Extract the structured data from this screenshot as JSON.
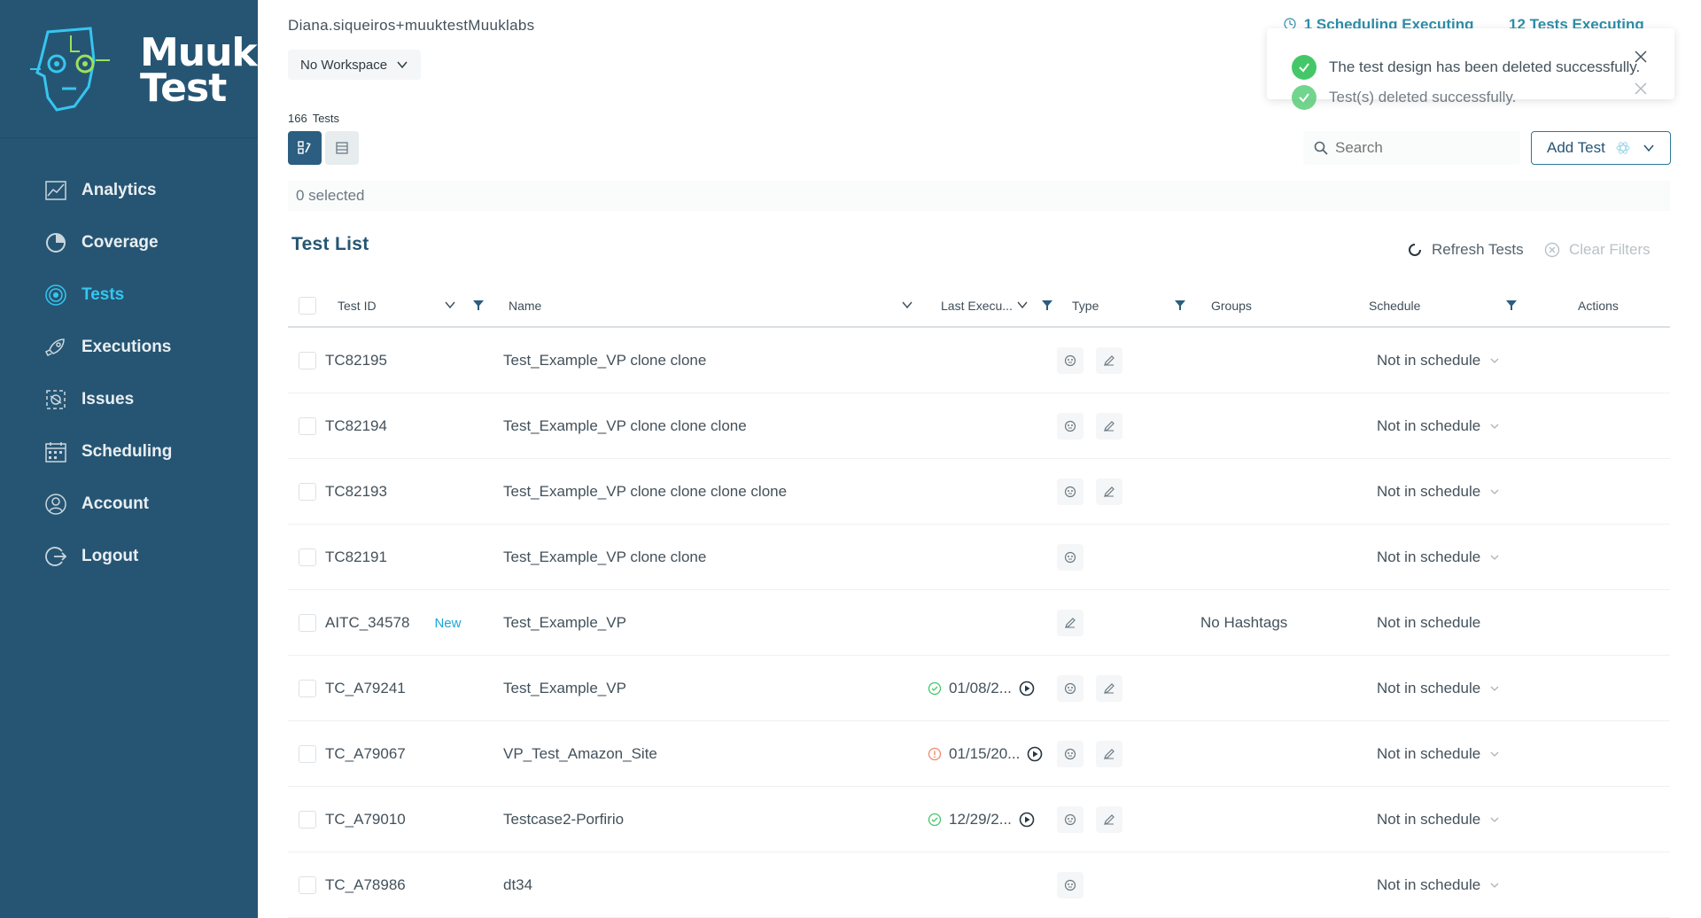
{
  "brand": {
    "logo_line1": "Muuk",
    "logo_line2": "Test",
    "accent": "#35c6f0",
    "sidebar_bg": "#265573"
  },
  "sidebar": {
    "items": [
      {
        "label": "Analytics",
        "icon": "analytics-icon"
      },
      {
        "label": "Coverage",
        "icon": "coverage-icon"
      },
      {
        "label": "Tests",
        "icon": "tests-icon",
        "active": true
      },
      {
        "label": "Executions",
        "icon": "rocket-icon"
      },
      {
        "label": "Issues",
        "icon": "bug-icon"
      },
      {
        "label": "Scheduling",
        "icon": "calendar-icon"
      },
      {
        "label": "Account",
        "icon": "user-icon"
      },
      {
        "label": "Logout",
        "icon": "logout-icon"
      }
    ]
  },
  "header": {
    "user": "Diana.siqueiros+muuktestMuuklabs",
    "workspace": "No Workspace",
    "scheduling_status": "1 Scheduling Executing",
    "tests_status": "12 Tests Executing"
  },
  "toolbar": {
    "tests_count": "166",
    "tests_label": "Tests",
    "selected": "0 selected",
    "search_placeholder": "Search",
    "add_test": "Add Test"
  },
  "list": {
    "title": "Test List",
    "refresh": "Refresh Tests",
    "clear": "Clear Filters",
    "columns": {
      "test_id": "Test ID",
      "name": "Name",
      "last_exec": "Last Execu...",
      "type": "Type",
      "groups": "Groups",
      "schedule": "Schedule",
      "actions": "Actions"
    },
    "rows": [
      {
        "id": "TC82195",
        "name": "Test_Example_VP clone clone",
        "exec": "",
        "groups": "",
        "schedule": "Not in schedule"
      },
      {
        "id": "TC82194",
        "name": "Test_Example_VP clone clone clone",
        "exec": "",
        "groups": "",
        "schedule": "Not in schedule"
      },
      {
        "id": "TC82193",
        "name": "Test_Example_VP clone clone clone clone",
        "exec": "",
        "groups": "",
        "schedule": "Not in schedule"
      },
      {
        "id": "TC82191",
        "name": "Test_Example_VP clone clone",
        "exec": "",
        "groups": "",
        "schedule": "Not in schedule"
      },
      {
        "id": "AITC_34578",
        "badge": "New",
        "name": "Test_Example_VP",
        "exec": "",
        "groups": "No Hashtags",
        "schedule": "Not in schedule"
      },
      {
        "id": "TC_A79241",
        "name": "Test_Example_VP",
        "exec": "01/08/2...",
        "exec_status": "success",
        "groups": "",
        "schedule": "Not in schedule"
      },
      {
        "id": "TC_A79067",
        "name": "VP_Test_Amazon_Site",
        "exec": "01/15/20...",
        "exec_status": "error",
        "groups": "",
        "schedule": "Not in schedule"
      },
      {
        "id": "TC_A79010",
        "name": "Testcase2-Porfirio",
        "exec": "12/29/2...",
        "exec_status": "success",
        "groups": "",
        "schedule": "Not in schedule"
      },
      {
        "id": "TC_A78986",
        "name": "dt34",
        "exec": "",
        "groups": "",
        "schedule": "Not in schedule"
      }
    ]
  },
  "toasts": [
    {
      "text": "The test design has been deleted successfully."
    },
    {
      "text": "Test(s) deleted successfully."
    }
  ]
}
